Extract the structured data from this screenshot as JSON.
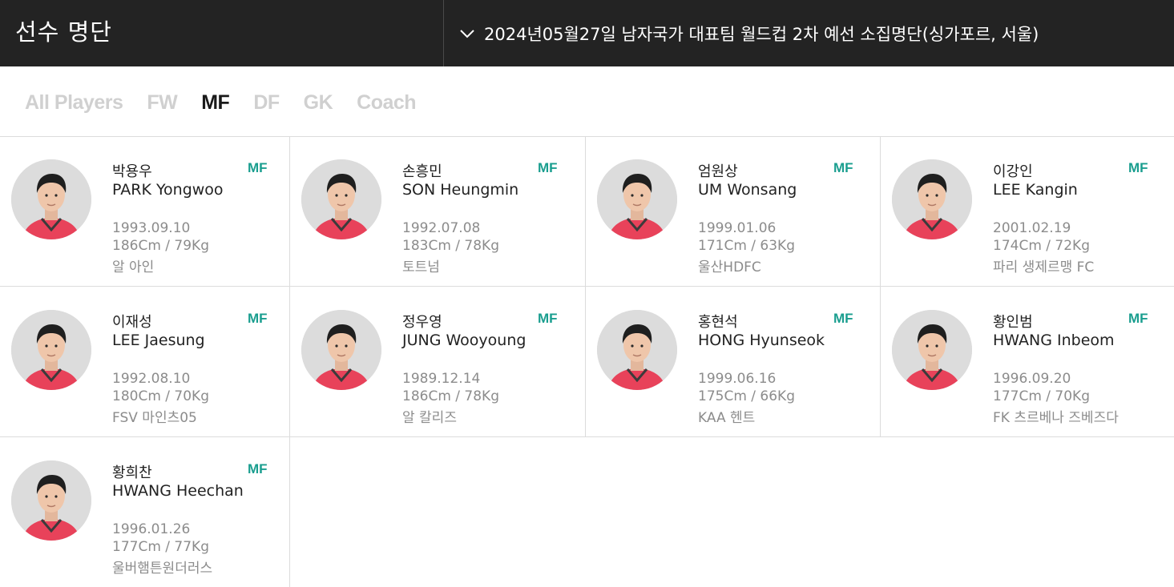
{
  "header": {
    "title": "선수 명단",
    "selector_label": "2024년05월27일 남자국가 대표팀 월드컵 2차 예선 소집명단(싱가포르, 서울)"
  },
  "tabs": [
    {
      "label": "All Players",
      "active": false
    },
    {
      "label": "FW",
      "active": false
    },
    {
      "label": "MF",
      "active": true
    },
    {
      "label": "DF",
      "active": false
    },
    {
      "label": "GK",
      "active": false
    },
    {
      "label": "Coach",
      "active": false
    }
  ],
  "colors": {
    "header_bg": "#232323",
    "position_accent": "#1a9e8f",
    "tab_inactive": "#d0d0d0",
    "tab_active": "#1a1a1a",
    "jersey": "#e8425a"
  },
  "players": [
    {
      "name_ko": "박용우",
      "name_en": "PARK Yongwoo",
      "position": "MF",
      "dob": "1993.09.10",
      "body": "186Cm / 79Kg",
      "club": "알 아인"
    },
    {
      "name_ko": "손흥민",
      "name_en": "SON Heungmin",
      "position": "MF",
      "dob": "1992.07.08",
      "body": "183Cm / 78Kg",
      "club": "토트넘"
    },
    {
      "name_ko": "엄원상",
      "name_en": "UM Wonsang",
      "position": "MF",
      "dob": "1999.01.06",
      "body": "171Cm / 63Kg",
      "club": "울산HDFC"
    },
    {
      "name_ko": "이강인",
      "name_en": "LEE Kangin",
      "position": "MF",
      "dob": "2001.02.19",
      "body": "174Cm / 72Kg",
      "club": "파리 생제르맹 FC"
    },
    {
      "name_ko": "이재성",
      "name_en": "LEE Jaesung",
      "position": "MF",
      "dob": "1992.08.10",
      "body": "180Cm / 70Kg",
      "club": "FSV 마인츠05"
    },
    {
      "name_ko": "정우영",
      "name_en": "JUNG Wooyoung",
      "position": "MF",
      "dob": "1989.12.14",
      "body": "186Cm / 78Kg",
      "club": "알 칼리즈"
    },
    {
      "name_ko": "홍현석",
      "name_en": "HONG Hyunseok",
      "position": "MF",
      "dob": "1999.06.16",
      "body": "175Cm / 66Kg",
      "club": "KAA 헨트"
    },
    {
      "name_ko": "황인범",
      "name_en": "HWANG Inbeom",
      "position": "MF",
      "dob": "1996.09.20",
      "body": "177Cm / 70Kg",
      "club": "FK 츠르베나 즈베즈다"
    },
    {
      "name_ko": "황희찬",
      "name_en": "HWANG Heechan",
      "position": "MF",
      "dob": "1996.01.26",
      "body": "177Cm / 77Kg",
      "club": "울버햄튼원더러스"
    }
  ]
}
